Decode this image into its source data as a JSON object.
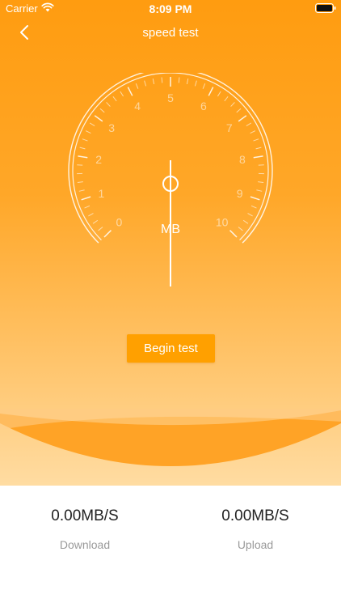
{
  "status_bar": {
    "carrier": "Carrier",
    "time": "8:09 PM"
  },
  "nav": {
    "title": "speed test",
    "back_icon": "chevron-left-icon"
  },
  "gauge": {
    "unit": "MB",
    "scale_labels": [
      "0",
      "1",
      "2",
      "3",
      "4",
      "5",
      "6",
      "7",
      "8",
      "9",
      "10"
    ],
    "current_value": 0,
    "min": 0,
    "max": 10
  },
  "actions": {
    "begin_label": "Begin test"
  },
  "stats": {
    "download": {
      "value": "0.00MB/S",
      "label": "Download"
    },
    "upload": {
      "value": "0.00MB/S",
      "label": "Upload"
    }
  },
  "colors": {
    "accent": "#ffa000",
    "gradient_top": "#ff9c10",
    "gradient_bottom": "#ffdca2",
    "wave": "#ffa326"
  }
}
